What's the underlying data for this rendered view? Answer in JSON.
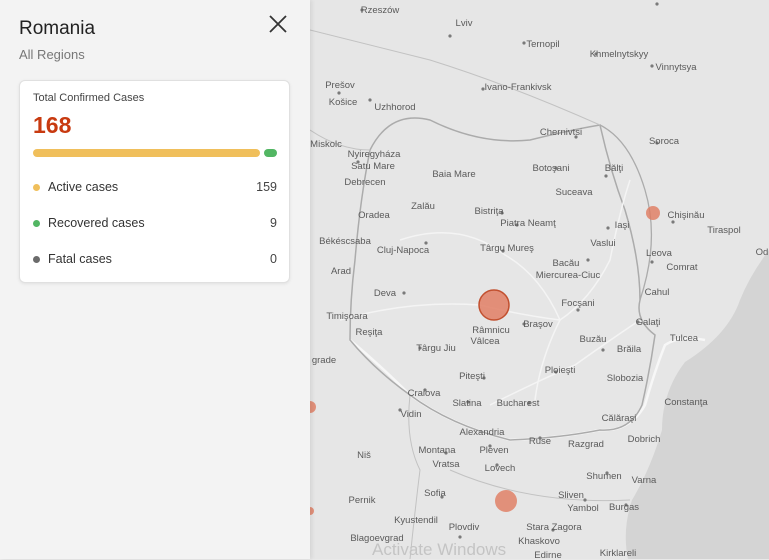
{
  "panel": {
    "title": "Romania",
    "subtitle": "All Regions",
    "total_label": "Total Confirmed Cases",
    "total_value": "168",
    "stats": [
      {
        "label": "Active cases",
        "value": "159",
        "color": "#f0bf5b"
      },
      {
        "label": "Recovered cases",
        "value": "9",
        "color": "#52b663"
      },
      {
        "label": "Fatal cases",
        "value": "0",
        "color": "#6b6b6b"
      }
    ],
    "progress": {
      "active_fraction": 0.946,
      "recovered_fraction": 0.054
    }
  },
  "map": {
    "bubble_color": "#e07a5f",
    "cities": [
      "Rzeszów",
      "Lviv",
      "Ternopil",
      "Khmelnytskyy",
      "Vinnytsya",
      "Prešov",
      "Košice",
      "Uzhhorod",
      "Ivano-Frankivsk",
      "Chernivtsi",
      "Soroca",
      "Miskolc",
      "Nyiregyháza",
      "Satu Mare",
      "Botoşani",
      "Bălţi",
      "Debrecen",
      "Baia Mare",
      "Suceava",
      "Zalău",
      "Bistriţa",
      "Piatra Neamţ",
      "Iaşi",
      "Chişinău",
      "Oradea",
      "Tiraspol",
      "Békéscsaba",
      "Cluj-Napoca",
      "Vaslui",
      "Târgu Mureş",
      "Bacău",
      "Leova",
      "Miercurea-Ciuc",
      "Comrat",
      "Arad",
      "Cahul",
      "Deva",
      "Focşani",
      "Timişoara",
      "Reşiţa",
      "Braşov",
      "Galaţi",
      "Râmnicu",
      "Vâlcea",
      "Tulcea",
      "Buzău",
      "Brăila",
      "Târgu Jiu",
      "Ploieşti",
      "Slobozia",
      "Craiova",
      "Piteşti",
      "Constanţa",
      "Vidin",
      "Slatina",
      "Bucharest",
      "Călăraşi",
      "Alexandria",
      "Ruse",
      "Dobrich",
      "Razgrad",
      "Montana",
      "Pleven",
      "Vratsa",
      "Niš",
      "Lovech",
      "Shumen",
      "Varna",
      "Sofia",
      "Sliven",
      "Pernik",
      "Yambol",
      "Burgas",
      "Kyustendil",
      "Plovdiv",
      "Stara Zagora",
      "Blagoevgrad",
      "Khaskovo",
      "Edirne",
      "Kirklareli",
      "grade",
      "Od"
    ],
    "watermark": "Activate Windows"
  }
}
